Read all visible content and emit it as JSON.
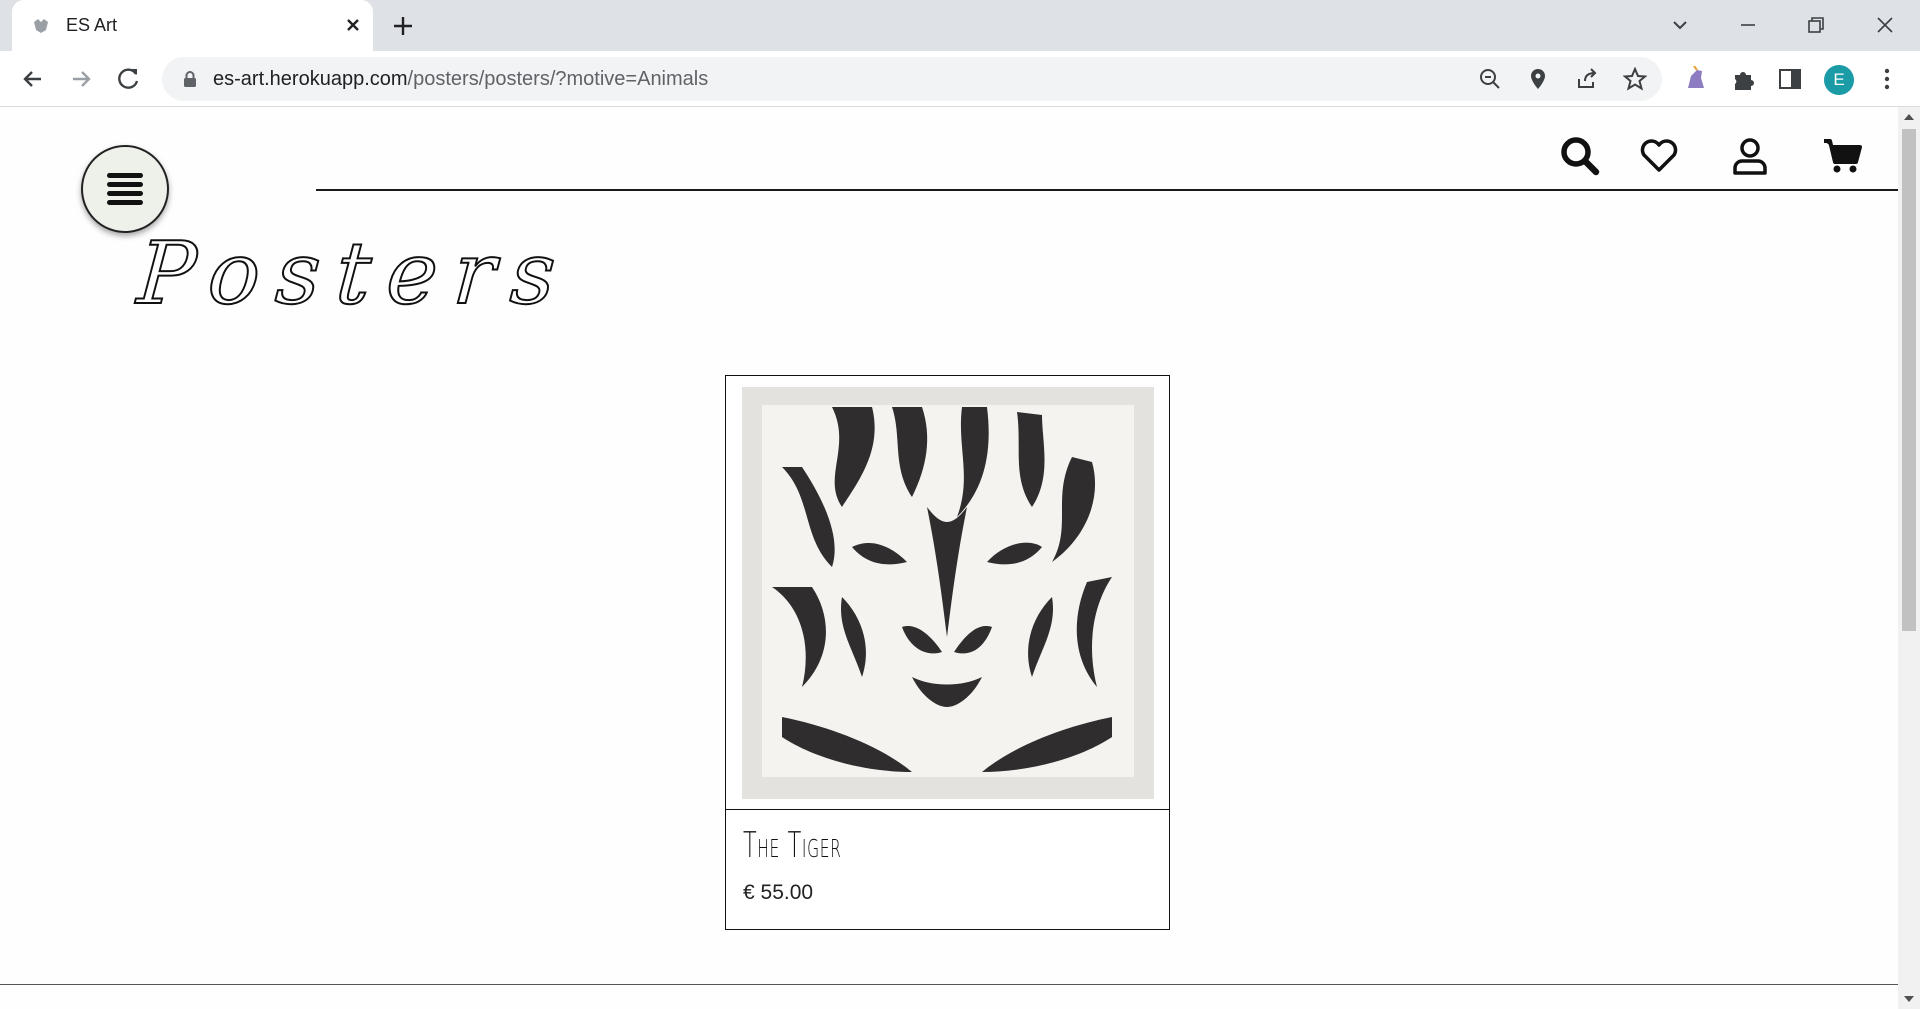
{
  "browser": {
    "tab_title": "ES Art",
    "url_host": "es-art.herokuapp.com",
    "url_path": "/posters/posters/?motive=Animals",
    "profile_initial": "E"
  },
  "page": {
    "title": "Posters",
    "products": [
      {
        "name": "The Tiger",
        "price": "€ 55.00",
        "image": "tiger-poster-image"
      }
    ]
  },
  "icons": {
    "header": [
      "search-icon",
      "heart-icon",
      "user-icon",
      "cart-icon"
    ],
    "menu": "hamburger-icon"
  }
}
